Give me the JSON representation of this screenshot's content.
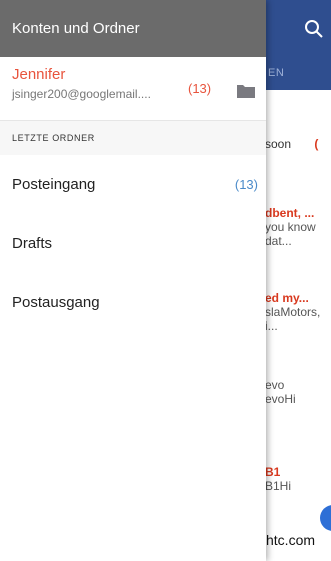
{
  "drawer": {
    "title": "Konten und Ordner",
    "account": {
      "name": "Jennifer",
      "email": "jsinger200@googlemail....",
      "unread_count": "(13)",
      "folder_icon": "folder-icon"
    },
    "section_label": "LETZTE ORDNER",
    "folders": [
      {
        "label": "Posteingang",
        "badge": "(13)"
      },
      {
        "label": "Drafts",
        "badge": ""
      },
      {
        "label": "Postausgang",
        "badge": ""
      }
    ]
  },
  "background": {
    "tab_label": "EN",
    "items": [
      {
        "line1": "soon",
        "line2": "("
      },
      {
        "line1": "dbent, ...",
        "line2": "you know",
        "line3": "dat..."
      },
      {
        "line1": "ed my...",
        "line2": "slaMotors,",
        "line3": "i..."
      },
      {
        "line1": "evo",
        "line2": "evoHi"
      },
      {
        "line1": "B1",
        "line2": "B1Hi"
      }
    ],
    "footer": "htc.com"
  },
  "colors": {
    "accent_red": "#e8543d",
    "header_gray": "#6b6b6b",
    "app_blue": "#2f4e8f",
    "badge_blue": "#4a8ac9"
  }
}
